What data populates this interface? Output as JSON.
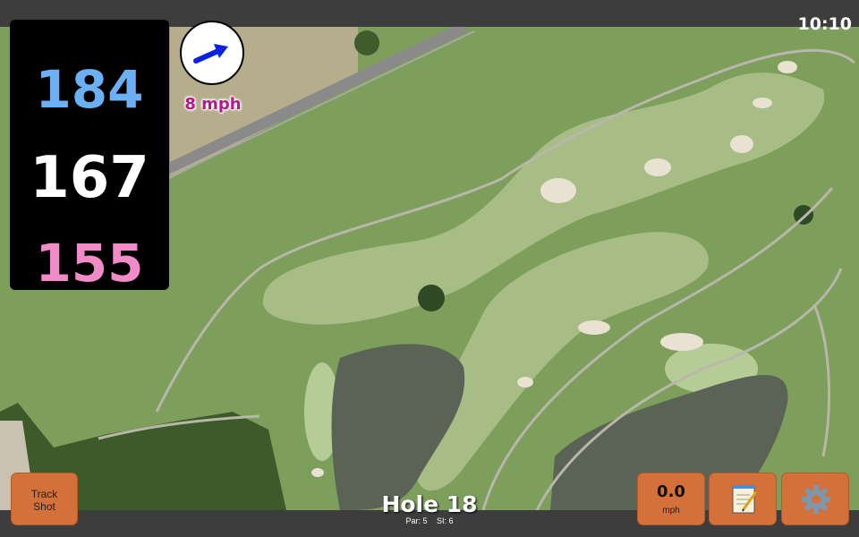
{
  "status": {
    "time": "10:10"
  },
  "distances": {
    "back": "184",
    "middle": "167",
    "front": "155"
  },
  "wind": {
    "speed": "8 mph",
    "icon": "wind-direction-arrow-icon"
  },
  "buttons": {
    "track_shot_line1": "Track",
    "track_shot_line2": "Shot",
    "speed_value": "0.0",
    "speed_unit": "mph",
    "notes_icon": "notepad-icon",
    "settings_icon": "gear-icon"
  },
  "hole": {
    "title": "Hole 18",
    "par": "Par: 5",
    "si": "SI: 6"
  },
  "colors": {
    "back": "#6ab0f3",
    "middle": "#ffffff",
    "front": "#f08bc8",
    "wind_text": "#b01c90",
    "button": "#d4703a"
  }
}
